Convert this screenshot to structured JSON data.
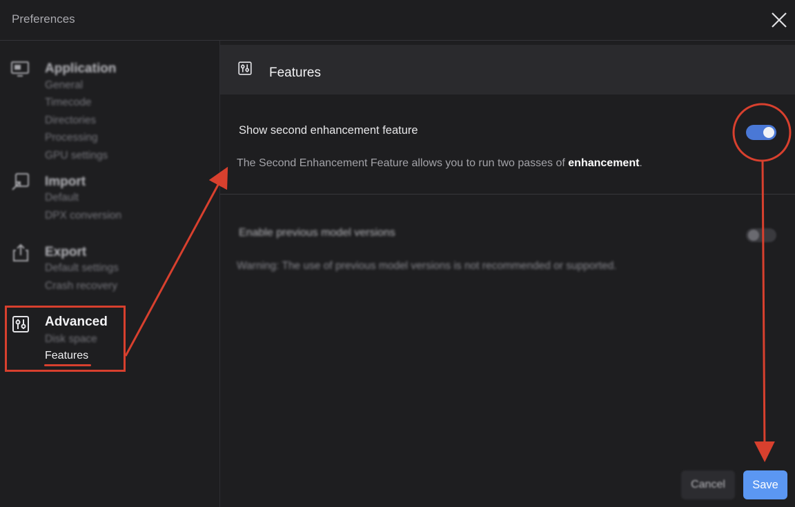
{
  "window": {
    "title": "Preferences"
  },
  "sidebar": {
    "groups": [
      {
        "heading": "Application",
        "icon": "monitor-icon",
        "items": [
          "General",
          "Timecode",
          "Directories",
          "Processing",
          "GPU settings"
        ]
      },
      {
        "heading": "Import",
        "icon": "import-icon",
        "items": [
          "Default",
          "DPX conversion"
        ]
      },
      {
        "heading": "Export",
        "icon": "export-icon",
        "items": [
          "Default settings",
          "Crash recovery"
        ]
      },
      {
        "heading": "Advanced",
        "icon": "sliders-icon",
        "items": [
          "Disk space",
          "Features"
        ]
      }
    ],
    "selected_item": "Features"
  },
  "main": {
    "header_title": "Features",
    "settings": [
      {
        "label": "Show second enhancement feature",
        "desc_prefix": "The Second Enhancement Feature allows you to run two passes of ",
        "desc_bold": "enhancement",
        "desc_suffix": ".",
        "enabled": true
      },
      {
        "label": "Enable previous model versions",
        "desc": "Warning: The use of previous model versions is not recommended or supported.",
        "enabled": false
      }
    ]
  },
  "footer": {
    "cancel_label": "Cancel",
    "save_label": "Save"
  },
  "colors": {
    "annotation": "#d8402e",
    "toggle_on": "#4a78d6",
    "save_button": "#5b97f2"
  }
}
